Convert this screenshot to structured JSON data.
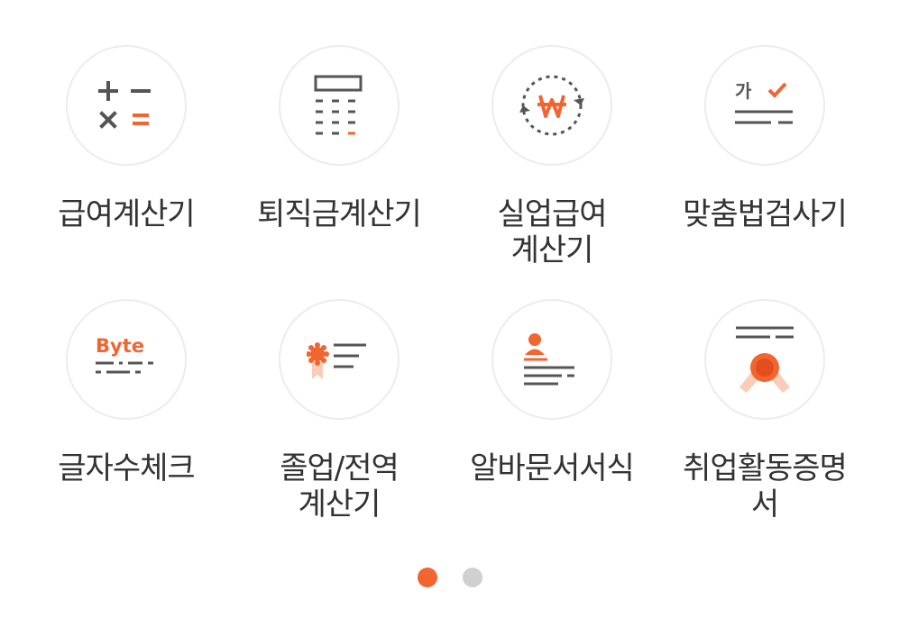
{
  "colors": {
    "accent": "#f26430",
    "icon_gray": "#555555",
    "dot_inactive": "#d0d0d0"
  },
  "tiles": [
    {
      "label": "급여계산기",
      "icon": "calculator-ops-icon"
    },
    {
      "label": "퇴직금계산기",
      "icon": "calculator-keypad-icon"
    },
    {
      "label": "실업급여\n계산기",
      "icon": "won-cycle-icon"
    },
    {
      "label": "맞춤법검사기",
      "icon": "spellcheck-icon",
      "icon_text": "가"
    },
    {
      "label": "글자수체크",
      "icon": "byte-count-icon",
      "icon_text": "Byte"
    },
    {
      "label": "졸업/전역\n계산기",
      "icon": "badge-list-icon"
    },
    {
      "label": "알바문서서식",
      "icon": "person-document-icon"
    },
    {
      "label": "취업활동증명\n서",
      "icon": "certificate-seal-icon"
    }
  ],
  "pagination": {
    "total": 2,
    "current": 1
  }
}
